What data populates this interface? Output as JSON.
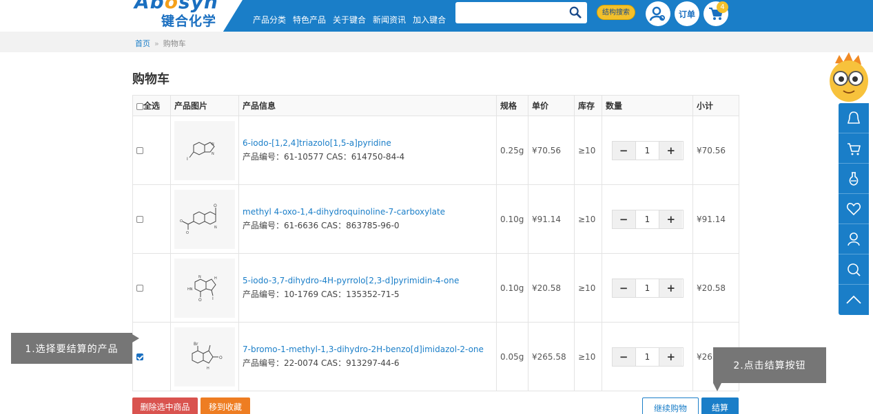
{
  "header": {
    "logo_latin": "Aboosyn",
    "logo_latin_o": "o",
    "logo_latin_pre": "Ab",
    "logo_latin_post": "syn",
    "logo_cn": "键合化学",
    "nav": [
      "产品分类",
      "特色产品",
      "关于键合",
      "新闻资讯",
      "加入键合"
    ],
    "search": {
      "value": "",
      "placeholder": ""
    },
    "structure_search_label": "结构搜索",
    "order_label": "订单",
    "cart_count": "4"
  },
  "breadcrumb": {
    "home": "首页",
    "sep": "»",
    "current": "购物车"
  },
  "page_title": "购物车",
  "table": {
    "headers": {
      "select_all": "全选",
      "image": "产品图片",
      "info": "产品信息",
      "spec": "规格",
      "price": "单价",
      "stock": "库存",
      "qty": "数量",
      "subtotal": "小计"
    },
    "rows": [
      {
        "checked": false,
        "name": "6-iodo-[1,2,4]triazolo[1,5-a]pyridine",
        "code": "产品编号：61-10577 CAS：614750-84-4",
        "spec": "0.25g",
        "price": "¥70.56",
        "stock": "≥10",
        "qty": "1",
        "subtotal": "¥70.56"
      },
      {
        "checked": false,
        "name": "methyl 4-oxo-1,4-dihydroquinoline-7-carboxylate",
        "code": "产品编号：61-6636 CAS：863785-96-0",
        "spec": "0.10g",
        "price": "¥91.14",
        "stock": "≥10",
        "qty": "1",
        "subtotal": "¥91.14"
      },
      {
        "checked": false,
        "name": "5-iodo-3,7-dihydro-4H-pyrrolo[2,3-d]pyrimidin-4-one",
        "code": "产品编号：10-1769 CAS：135352-71-5",
        "spec": "0.10g",
        "price": "¥20.58",
        "stock": "≥10",
        "qty": "1",
        "subtotal": "¥20.58"
      },
      {
        "checked": true,
        "name": "7-bromo-1-methyl-1,3-dihydro-2H-benzo[d]imidazol-2-one",
        "code": "产品编号：22-0074 CAS：913297-44-6",
        "spec": "0.05g",
        "price": "¥265.58",
        "stock": "≥10",
        "qty": "1",
        "subtotal": "¥265.58"
      }
    ],
    "minus": "−",
    "plus": "+"
  },
  "actions": {
    "delete_selected": "删除选中商品",
    "move_to_favorites": "移到收藏",
    "continue_shopping": "继续购物",
    "checkout": "结算"
  },
  "annotations": {
    "step1": "1.选择要结算的产品",
    "step2": "2.点击结算按钮"
  },
  "sidebar": {
    "icons": [
      "chat-icon",
      "cart-icon",
      "flask-icon",
      "heart-icon",
      "user-icon",
      "search-icon",
      "up-arrow-icon"
    ]
  },
  "colors": {
    "brand_blue": "#1a7ec8",
    "accent_yellow": "#f3c02a",
    "delete_red": "#d9534f",
    "favorite_orange": "#ee7d22",
    "annotation_gray": "#767676"
  }
}
